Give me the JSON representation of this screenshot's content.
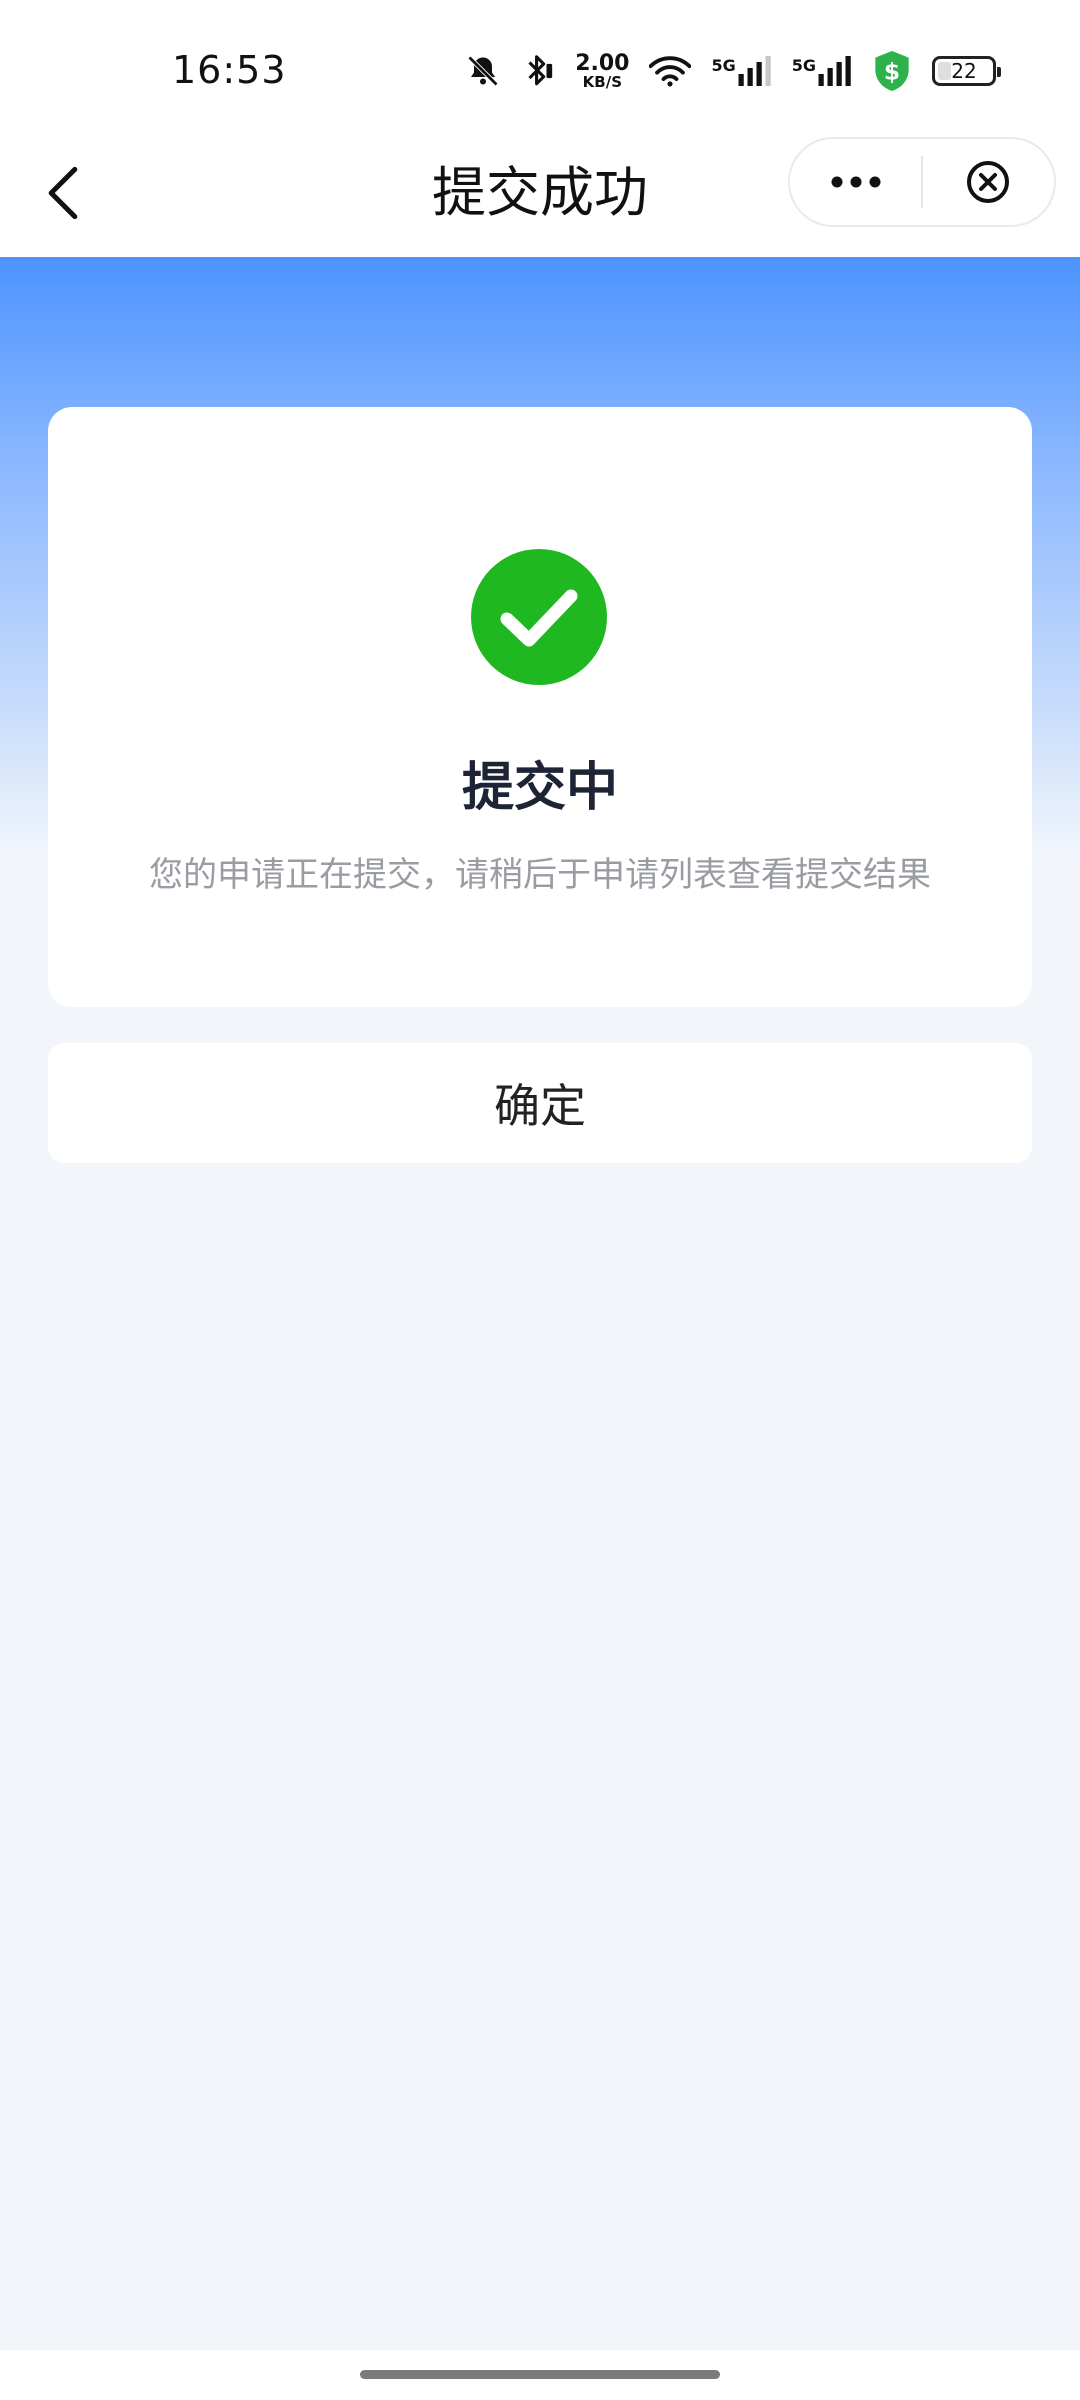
{
  "status_bar": {
    "time": "16:53",
    "net_speed_value": "2.00",
    "net_speed_unit": "KB/S",
    "network_1": "5G",
    "network_2": "5G",
    "battery_level": "22",
    "shield_color": "#2db34a",
    "icons": [
      "bell-muted-icon",
      "bluetooth-icon",
      "wifi-icon",
      "signal-icon",
      "security-shield-icon",
      "battery-icon"
    ]
  },
  "nav": {
    "title": "提交成功",
    "back_icon": "chevron-left-icon",
    "more_icon": "more-dots-icon",
    "close_icon": "close-circle-icon"
  },
  "result": {
    "icon": "check-circle-icon",
    "icon_color": "#1fb820",
    "title": "提交中",
    "description": "您的申请正在提交，请稍后于申请列表查看提交结果"
  },
  "actions": {
    "confirm_label": "确定"
  },
  "theme": {
    "header_gradient_top": "#4d94ff",
    "page_background": "#f2f6fb"
  }
}
